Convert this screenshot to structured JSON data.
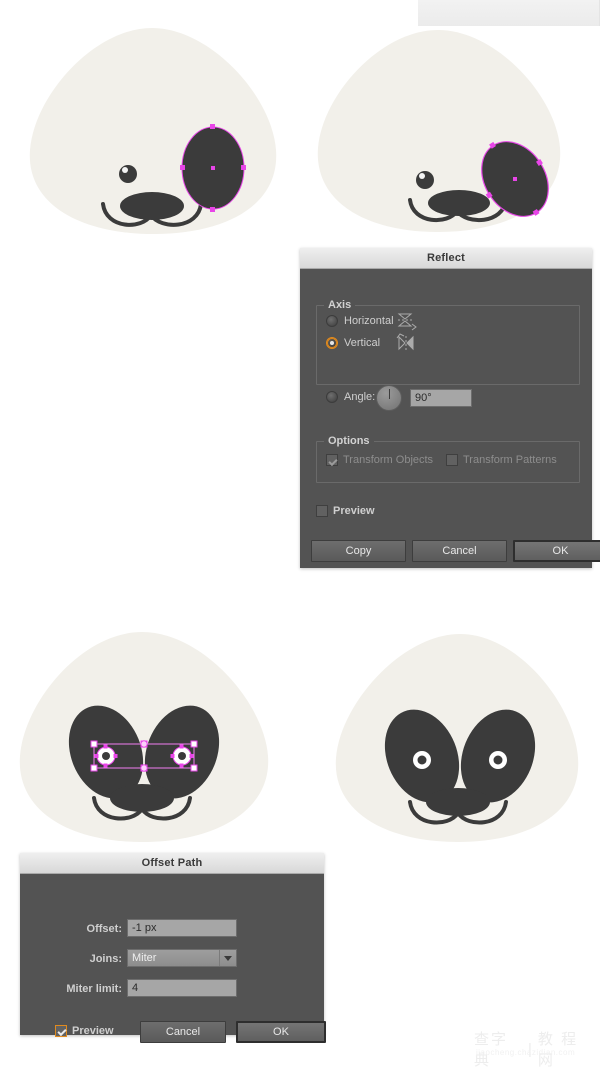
{
  "app": {
    "background_color": "#ffffff",
    "artwork_fill": "#f2f0ea",
    "artwork_dark": "#3b3b3b",
    "selection_color": "#e845e8",
    "accent_color": "#e08a1e"
  },
  "artboards": [
    {
      "name": "panda-step-1-right-eye-patch-selected",
      "caption": ""
    },
    {
      "name": "panda-step-2-right-eye-patch-rotated",
      "caption": ""
    },
    {
      "name": "panda-step-3-both-eye-patches-pupils-selected",
      "caption": ""
    },
    {
      "name": "panda-step-4-final-face",
      "caption": ""
    }
  ],
  "reflect_dialog": {
    "title": "Reflect",
    "axis_group_label": "Axis",
    "options": [
      {
        "label": "Horizontal",
        "selected": false,
        "icon": "reflect-horizontal-icon"
      },
      {
        "label": "Vertical",
        "selected": true,
        "icon": "reflect-vertical-icon"
      },
      {
        "label": "Angle:",
        "selected": false,
        "icon": "angle-dial-icon"
      }
    ],
    "angle_value": "90°",
    "options_group_label": "Options",
    "transform_objects": {
      "label": "Transform Objects",
      "checked": true,
      "enabled": false
    },
    "transform_patterns": {
      "label": "Transform Patterns",
      "checked": false,
      "enabled": false
    },
    "preview": {
      "label": "Preview",
      "checked": false
    },
    "buttons": [
      {
        "label": "Copy",
        "default": false
      },
      {
        "label": "Cancel",
        "default": false
      },
      {
        "label": "OK",
        "default": true
      }
    ]
  },
  "offset_path_dialog": {
    "title": "Offset Path",
    "fields": [
      {
        "label": "Offset:",
        "value": "-1 px",
        "type": "text"
      },
      {
        "label": "Joins:",
        "value": "Miter",
        "type": "select"
      },
      {
        "label": "Miter limit:",
        "value": "4",
        "type": "text"
      }
    ],
    "preview": {
      "label": "Preview",
      "checked": true
    },
    "buttons": [
      {
        "label": "Cancel",
        "default": false
      },
      {
        "label": "OK",
        "default": true
      }
    ]
  },
  "watermark": {
    "brand": "查字典",
    "divider": "|",
    "section": "教 程 网",
    "url": "jiaocheng.chazidian.com"
  }
}
